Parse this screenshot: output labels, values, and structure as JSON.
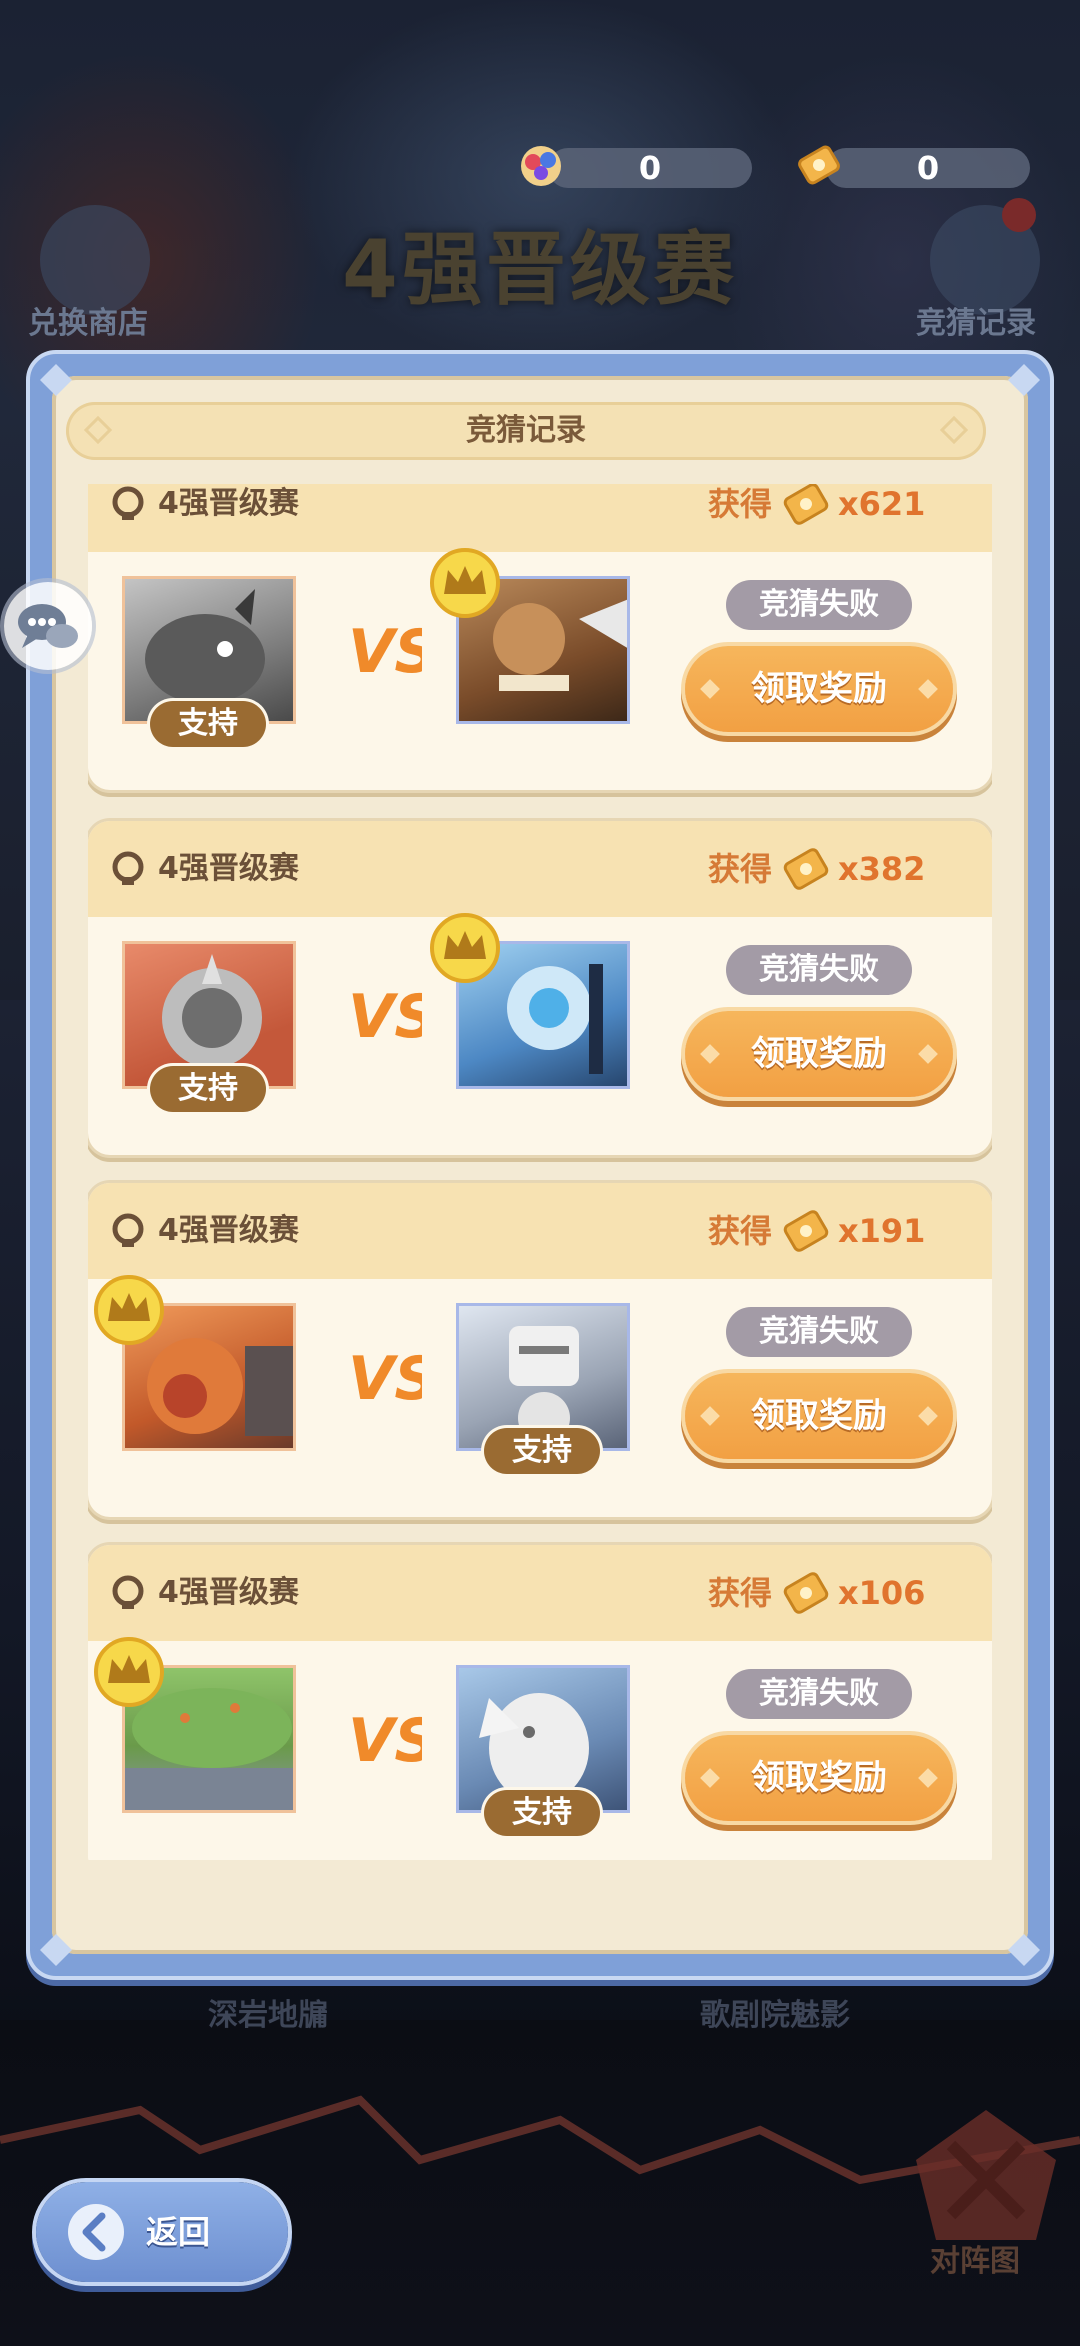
{
  "background": {
    "title": "4强晋级赛",
    "left_button_label": "兑换商店",
    "right_button_label": "竞猜记录",
    "bottom_left_text": "深岩地牖",
    "bottom_right_text": "歌剧院魅影"
  },
  "currencies": [
    {
      "icon": "gem-cluster-icon",
      "value": "0"
    },
    {
      "icon": "ticket-icon",
      "value": "0"
    }
  ],
  "modal": {
    "title": "竞猜记录",
    "records": [
      {
        "title": "4强晋级赛",
        "reward_label": "获得",
        "reward_icon": "ticket-icon",
        "reward_count": "x621",
        "left": {
          "creature": "gray-rhino-beast",
          "supported": true,
          "winner": false
        },
        "right": {
          "creature": "caveman-brute",
          "supported": false,
          "winner": true
        },
        "status": "竞猜失败",
        "claim_label": "领取奖励",
        "support_label": "支持"
      },
      {
        "title": "4强晋级赛",
        "reward_label": "获得",
        "reward_icon": "ticket-icon",
        "reward_count": "x382",
        "left": {
          "creature": "stone-shield-golem",
          "supported": true,
          "winner": false
        },
        "right": {
          "creature": "ice-robot-knight",
          "supported": false,
          "winner": true
        },
        "status": "竞猜失败",
        "claim_label": "领取奖励",
        "support_label": "支持"
      },
      {
        "title": "4强晋级赛",
        "reward_label": "获得",
        "reward_icon": "ticket-icon",
        "reward_count": "x191",
        "left": {
          "creature": "lava-rock-beast",
          "supported": false,
          "winner": true
        },
        "right": {
          "creature": "steel-mech-knight",
          "supported": true,
          "winner": false
        },
        "status": "竞猜失败",
        "claim_label": "领取奖励",
        "support_label": "支持"
      },
      {
        "title": "4强晋级赛",
        "reward_label": "获得",
        "reward_icon": "ticket-icon",
        "reward_count": "x106",
        "left": {
          "creature": "grass-rock-turtle",
          "supported": false,
          "winner": true
        },
        "right": {
          "creature": "white-griffin",
          "supported": true,
          "winner": false
        },
        "status": "竞猜失败",
        "claim_label": "领取奖励",
        "support_label": "支持"
      }
    ]
  },
  "back_button": {
    "label": "返回"
  },
  "formation_button": {
    "label": "对阵图"
  },
  "colors": {
    "accent_orange": "#f2a043",
    "status_gray": "#a39ba6",
    "modal_blue": "#7fa0d8",
    "support_brown": "#9a6b32"
  }
}
